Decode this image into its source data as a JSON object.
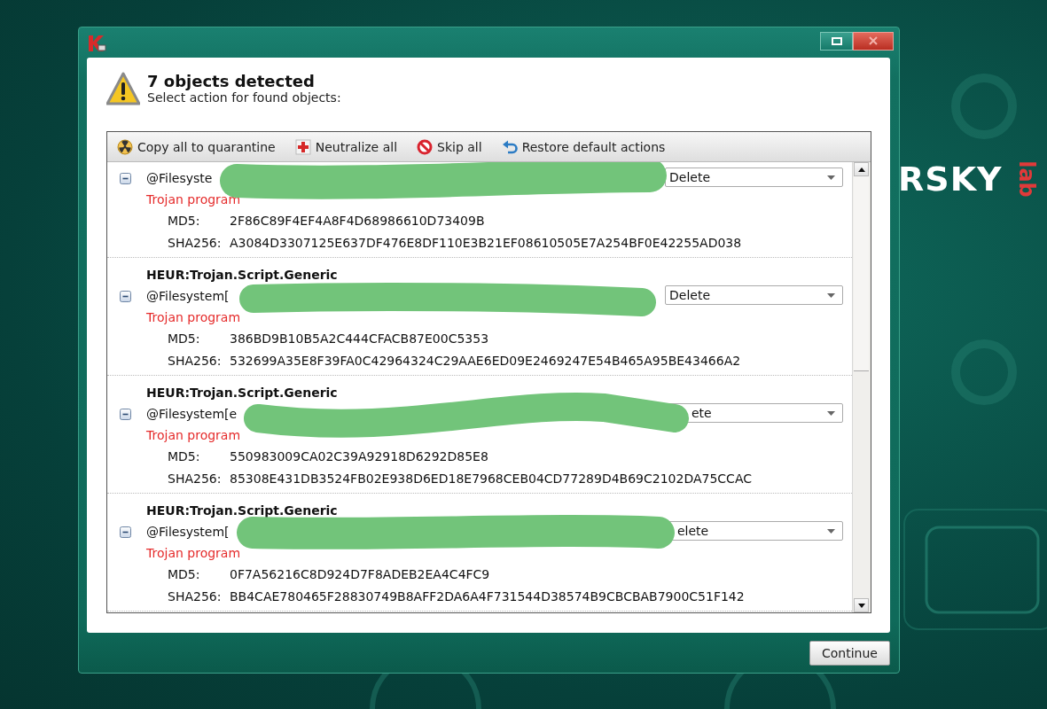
{
  "header": {
    "title": "7 objects detected",
    "subtitle": "Select action for found objects:"
  },
  "toolbar": [
    {
      "kind": "quarantine",
      "label": "Copy all to quarantine"
    },
    {
      "kind": "neutralize",
      "label": "Neutralize all"
    },
    {
      "kind": "skip",
      "label": "Skip all"
    },
    {
      "kind": "restore",
      "label": "Restore default actions"
    }
  ],
  "objects": [
    {
      "path": "@Filesyste",
      "action": "Delete",
      "expanded": true,
      "verdict": "Trojan program",
      "md5_label": "MD5:",
      "md5": "2F86C89F4EF4A8F4D68986610D73409B",
      "sha256_label": "SHA256:",
      "sha256": "A3084D3307125E637DF476E8DF110E3B21EF08610505E7A254BF0E42255AD038"
    },
    {
      "title": "HEUR:Trojan.Script.Generic",
      "path": "@Filesystem[",
      "action": "Delete",
      "expanded": true,
      "verdict": "Trojan program",
      "md5_label": "MD5:",
      "md5": "386BD9B10B5A2C444CFACB87E00C5353",
      "sha256_label": "SHA256:",
      "sha256": "532699A35E8F39FA0C42964324C29AAE6ED09E2469247E54B465A95BE43466A2"
    },
    {
      "title": "HEUR:Trojan.Script.Generic",
      "path": "@Filesystem[e",
      "action": "ete",
      "expanded": true,
      "verdict": "Trojan program",
      "md5_label": "MD5:",
      "md5": "550983009CA02C39A92918D6292D85E8",
      "sha256_label": "SHA256:",
      "sha256": "85308E431DB3524FB02E938D6ED18E7968CEB04CD77289D4B69C2102DA75CCAC"
    },
    {
      "title": "HEUR:Trojan.Script.Generic",
      "path": "@Filesystem[",
      "action": "elete",
      "expanded": true,
      "verdict": "Trojan program",
      "md5_label": "MD5:",
      "md5": "0F7A56216C8D924D7F8ADEB2EA4C4FC9",
      "sha256_label": "SHA256:",
      "sha256": "BB4CAE780465F28830749B8AFF2DA6A4F731544D38574B9CBCBAB7900C51F142"
    }
  ],
  "continue_button": "Continue",
  "brand": {
    "wordmark": "RSKY",
    "suffix": "lab"
  }
}
